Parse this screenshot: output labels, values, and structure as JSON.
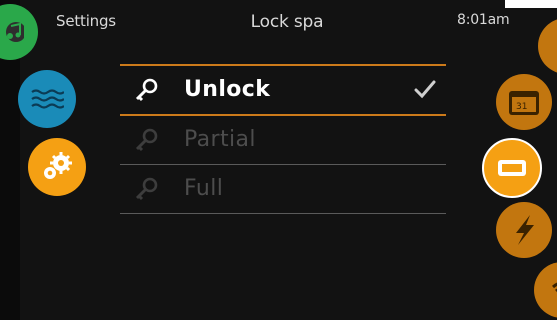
{
  "header": {
    "left": "Settings",
    "title": "Lock spa",
    "time": "8:01am"
  },
  "menu": {
    "items": [
      {
        "label": "Unlock",
        "selected": true
      },
      {
        "label": "Partial",
        "selected": false
      },
      {
        "label": "Full",
        "selected": false
      }
    ]
  },
  "icons": {
    "left": [
      "music-icon",
      "water-icon",
      "settings-icon"
    ],
    "right": [
      "speaker-icon",
      "calendar-icon",
      "screen-icon",
      "power-icon",
      "wifi-icon"
    ]
  },
  "colors": {
    "accent": "#f5a013",
    "orange_dim": "#c2760f",
    "green": "#2aa84a",
    "teal": "#1a8bb8"
  }
}
